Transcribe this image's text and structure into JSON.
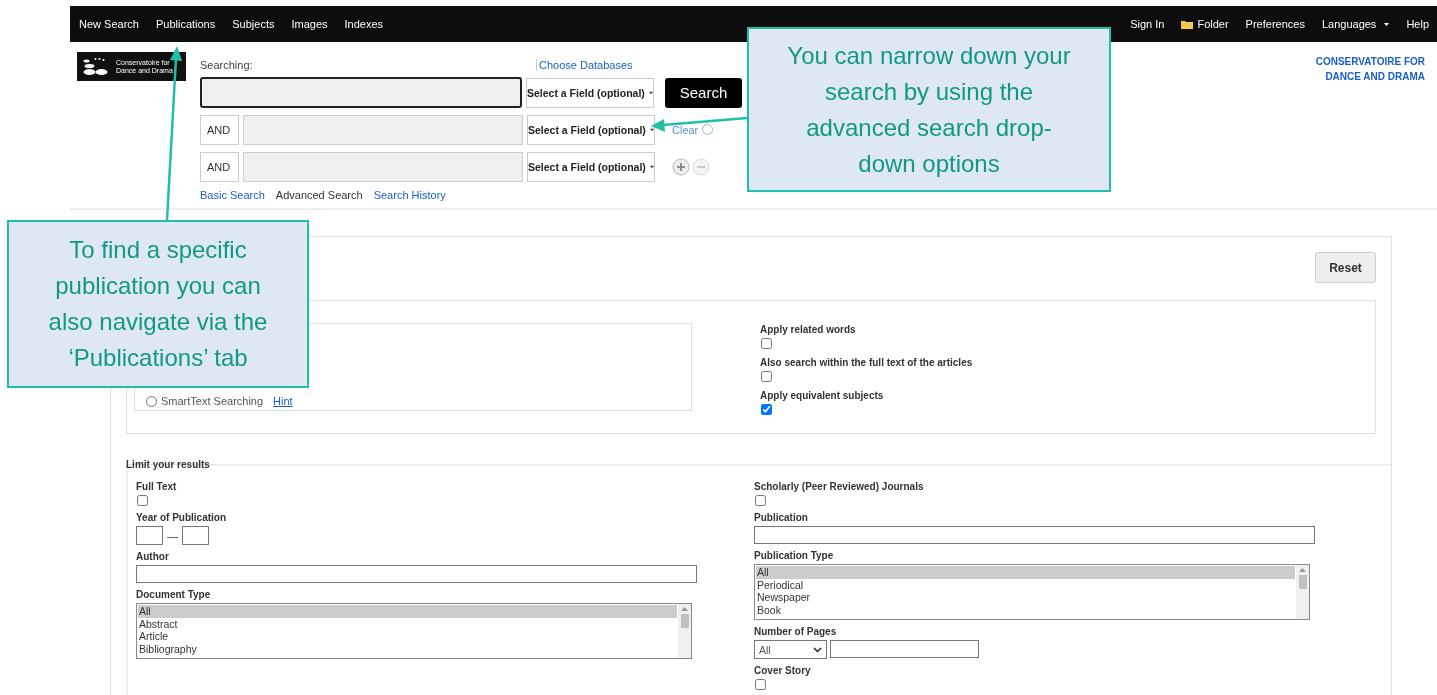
{
  "nav": {
    "left": [
      {
        "label": "New Search"
      },
      {
        "label": "Publications"
      },
      {
        "label": "Subjects"
      },
      {
        "label": "Images"
      },
      {
        "label": "Indexes"
      }
    ],
    "right": [
      {
        "label": "Sign In",
        "kind": "link"
      },
      {
        "label": "Folder",
        "kind": "folder"
      },
      {
        "label": "Preferences",
        "kind": "link"
      },
      {
        "label": "Languages",
        "kind": "dropdown"
      },
      {
        "label": "Help",
        "kind": "link"
      }
    ]
  },
  "logo": {
    "caption": "Conservatoire for Dance and Drama"
  },
  "institution": "CONSERVATOIRE FOR DANCE AND DRAMA",
  "search": {
    "label": "Searching:",
    "choose_databases": "Choose Databases",
    "button": "Search",
    "clear": "Clear",
    "rows": [
      {
        "kind": "main",
        "field": "Select a Field (optional)"
      },
      {
        "kind": "boolean",
        "operator": "AND",
        "field": "Select a Field (optional)"
      },
      {
        "kind": "boolean",
        "operator": "AND",
        "field": "Select a Field (optional)"
      }
    ],
    "links": [
      {
        "label": "Basic Search",
        "selected": false
      },
      {
        "label": "Advanced Search",
        "selected": true
      },
      {
        "label": "Search History",
        "selected": false
      }
    ]
  },
  "reset": "Reset",
  "search_modes": [
    {
      "label": "SmartText Searching",
      "hint": "Hint",
      "selected": false
    }
  ],
  "options": [
    {
      "label": "Apply related words",
      "checked": false
    },
    {
      "label": "Also search within the full text of the articles",
      "checked": false
    },
    {
      "label": "Apply equivalent subjects",
      "checked": true
    }
  ],
  "limits": {
    "legend": "Limit your results",
    "left": [
      {
        "kind": "checkbox",
        "label": "Full Text",
        "checked": false
      },
      {
        "kind": "year_range",
        "label": "Year of Publication",
        "separator": "—"
      },
      {
        "kind": "text",
        "label": "Author"
      },
      {
        "kind": "listbox",
        "label": "Document Type",
        "options": [
          {
            "label": "All",
            "selected": true
          },
          {
            "label": "Abstract",
            "selected": false
          },
          {
            "label": "Article",
            "selected": false
          },
          {
            "label": "Bibliography",
            "selected": false
          }
        ]
      }
    ],
    "right": [
      {
        "kind": "checkbox",
        "label": "Scholarly (Peer Reviewed) Journals",
        "checked": false
      },
      {
        "kind": "text",
        "label": "Publication"
      },
      {
        "kind": "listbox",
        "label": "Publication Type",
        "options": [
          {
            "label": "All",
            "selected": true
          },
          {
            "label": "Periodical",
            "selected": false
          },
          {
            "label": "Newspaper",
            "selected": false
          },
          {
            "label": "Book",
            "selected": false
          }
        ]
      },
      {
        "kind": "pages",
        "label": "Number of Pages",
        "value": "All"
      },
      {
        "kind": "checkbox",
        "label": "Cover Story",
        "checked": false
      }
    ]
  },
  "callouts": [
    {
      "text": "You can narrow down your search by using the advanced search drop-down options"
    },
    {
      "text": "To find a specific publication you can also navigate via the ‘Publications’ tab"
    }
  ]
}
